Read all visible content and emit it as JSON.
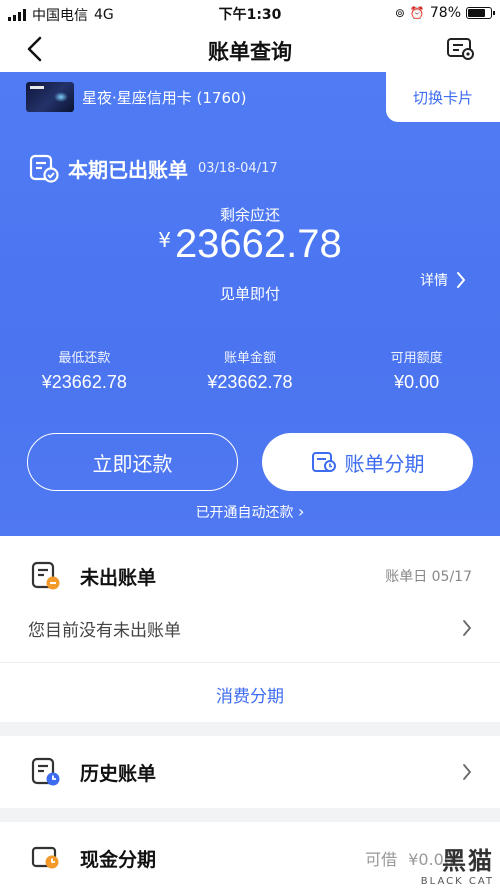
{
  "status_bar": {
    "carrier": "中国电信",
    "network": "4G",
    "time": "下午1:30",
    "battery": "78%",
    "battery_level": 0.78
  },
  "nav": {
    "title": "账单查询",
    "back_icon": "back-chevron-icon",
    "settings_icon": "bill-settings-icon"
  },
  "card": {
    "name": "星夜·星座信用卡 (1760)",
    "switch_label": "切换卡片"
  },
  "statement": {
    "title": "本期已出账单",
    "period": "03/18-04/17",
    "remaining_label": "剩余应还",
    "currency": "¥",
    "amount": "23662.78",
    "pay_note": "见单即付",
    "details_label": "详情"
  },
  "stats": [
    {
      "label": "最低还款",
      "value": "¥23662.78"
    },
    {
      "label": "账单金额",
      "value": "¥23662.78"
    },
    {
      "label": "可用额度",
      "value": "¥0.00"
    }
  ],
  "actions": {
    "repay_now": "立即还款",
    "installment": "账单分期",
    "autopay": "已开通自动还款"
  },
  "unbilled": {
    "title": "未出账单",
    "bill_day": "账单日 05/17",
    "empty_text": "您目前没有未出账单",
    "consumption_installment": "消费分期"
  },
  "history": {
    "title": "历史账单"
  },
  "cash_installment": {
    "title": "现金分期",
    "available_label": "可借",
    "available_value": "¥0.00"
  },
  "watermark": {
    "big": "黑猫",
    "small": "BLACK CAT"
  },
  "colors": {
    "accent": "#3d6cf0",
    "hero_bg": "#4b74f0",
    "page_bg": "#f2f3f5",
    "clock_orange": "#f39a2b",
    "clock_blue": "#3d6cf0"
  }
}
